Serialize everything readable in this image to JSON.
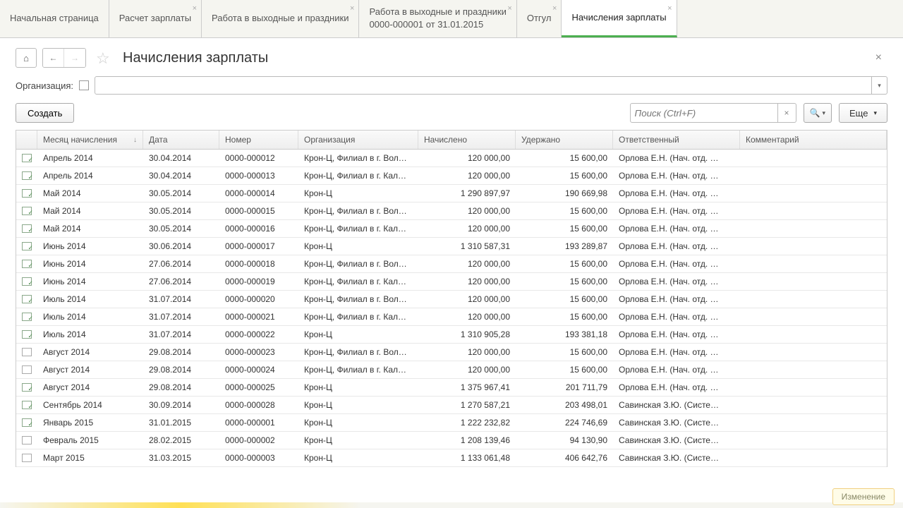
{
  "tabs": [
    {
      "label": "Начальная страница",
      "closable": false
    },
    {
      "label": "Расчет зарплаты",
      "closable": true
    },
    {
      "label": "Работа в выходные и праздники",
      "closable": true
    },
    {
      "label": "Работа в выходные и праздники\n0000-000001 от 31.01.2015",
      "closable": true
    },
    {
      "label": "Отгул",
      "closable": true
    },
    {
      "label": "Начисления зарплаты",
      "closable": true,
      "active": true
    }
  ],
  "pageTitle": "Начисления зарплаты",
  "filterLabel": "Организация:",
  "createBtn": "Создать",
  "searchPlaceholder": "Поиск (Ctrl+F)",
  "moreBtn": "Еще",
  "columns": {
    "month": "Месяц начисления",
    "date": "Дата",
    "number": "Номер",
    "org": "Организация",
    "accrued": "Начислено",
    "deducted": "Удержано",
    "responsible": "Ответственный",
    "comment": "Комментарий"
  },
  "popup": "Изменение",
  "rows": [
    {
      "posted": true,
      "month": "Апрель 2014",
      "date": "30.04.2014",
      "number": "0000-000012",
      "org": "Крон-Ц, Филиал в г. Вол…",
      "accrued": "120 000,00",
      "deducted": "15 600,00",
      "resp": "Орлова Е.Н. (Нач. отд. …"
    },
    {
      "posted": true,
      "month": "Апрель 2014",
      "date": "30.04.2014",
      "number": "0000-000013",
      "org": "Крон-Ц, Филиал в г. Кал…",
      "accrued": "120 000,00",
      "deducted": "15 600,00",
      "resp": "Орлова Е.Н. (Нач. отд. …"
    },
    {
      "posted": true,
      "month": "Май 2014",
      "date": "30.05.2014",
      "number": "0000-000014",
      "org": "Крон-Ц",
      "accrued": "1 290 897,97",
      "deducted": "190 669,98",
      "resp": "Орлова Е.Н. (Нач. отд. …"
    },
    {
      "posted": true,
      "month": "Май 2014",
      "date": "30.05.2014",
      "number": "0000-000015",
      "org": "Крон-Ц, Филиал в г. Вол…",
      "accrued": "120 000,00",
      "deducted": "15 600,00",
      "resp": "Орлова Е.Н. (Нач. отд. …"
    },
    {
      "posted": true,
      "month": "Май 2014",
      "date": "30.05.2014",
      "number": "0000-000016",
      "org": "Крон-Ц, Филиал в г. Кал…",
      "accrued": "120 000,00",
      "deducted": "15 600,00",
      "resp": "Орлова Е.Н. (Нач. отд. …"
    },
    {
      "posted": true,
      "month": "Июнь 2014",
      "date": "30.06.2014",
      "number": "0000-000017",
      "org": "Крон-Ц",
      "accrued": "1 310 587,31",
      "deducted": "193 289,87",
      "resp": "Орлова Е.Н. (Нач. отд. …"
    },
    {
      "posted": true,
      "month": "Июнь 2014",
      "date": "27.06.2014",
      "number": "0000-000018",
      "org": "Крон-Ц, Филиал в г. Вол…",
      "accrued": "120 000,00",
      "deducted": "15 600,00",
      "resp": "Орлова Е.Н. (Нач. отд. …"
    },
    {
      "posted": true,
      "month": "Июнь 2014",
      "date": "27.06.2014",
      "number": "0000-000019",
      "org": "Крон-Ц, Филиал в г. Кал…",
      "accrued": "120 000,00",
      "deducted": "15 600,00",
      "resp": "Орлова Е.Н. (Нач. отд. …"
    },
    {
      "posted": true,
      "month": "Июль 2014",
      "date": "31.07.2014",
      "number": "0000-000020",
      "org": "Крон-Ц, Филиал в г. Вол…",
      "accrued": "120 000,00",
      "deducted": "15 600,00",
      "resp": "Орлова Е.Н. (Нач. отд. …"
    },
    {
      "posted": true,
      "month": "Июль 2014",
      "date": "31.07.2014",
      "number": "0000-000021",
      "org": "Крон-Ц, Филиал в г. Кал…",
      "accrued": "120 000,00",
      "deducted": "15 600,00",
      "resp": "Орлова Е.Н. (Нач. отд. …"
    },
    {
      "posted": true,
      "month": "Июль 2014",
      "date": "31.07.2014",
      "number": "0000-000022",
      "org": "Крон-Ц",
      "accrued": "1 310 905,28",
      "deducted": "193 381,18",
      "resp": "Орлова Е.Н. (Нач. отд. …"
    },
    {
      "posted": false,
      "month": "Август 2014",
      "date": "29.08.2014",
      "number": "0000-000023",
      "org": "Крон-Ц, Филиал в г. Вол…",
      "accrued": "120 000,00",
      "deducted": "15 600,00",
      "resp": "Орлова Е.Н. (Нач. отд. …"
    },
    {
      "posted": false,
      "month": "Август 2014",
      "date": "29.08.2014",
      "number": "0000-000024",
      "org": "Крон-Ц, Филиал в г. Кал…",
      "accrued": "120 000,00",
      "deducted": "15 600,00",
      "resp": "Орлова Е.Н. (Нач. отд. …"
    },
    {
      "posted": true,
      "month": "Август 2014",
      "date": "29.08.2014",
      "number": "0000-000025",
      "org": "Крон-Ц",
      "accrued": "1 375 967,41",
      "deducted": "201 711,79",
      "resp": "Орлова Е.Н. (Нач. отд. …"
    },
    {
      "posted": true,
      "month": "Сентябрь 2014",
      "date": "30.09.2014",
      "number": "0000-000028",
      "org": "Крон-Ц",
      "accrued": "1 270 587,21",
      "deducted": "203 498,01",
      "resp": "Савинская З.Ю. (Систе…"
    },
    {
      "posted": true,
      "month": "Январь 2015",
      "date": "31.01.2015",
      "number": "0000-000001",
      "org": "Крон-Ц",
      "accrued": "1 222 232,82",
      "deducted": "224 746,69",
      "resp": "Савинская З.Ю. (Систе…"
    },
    {
      "posted": false,
      "month": "Февраль 2015",
      "date": "28.02.2015",
      "number": "0000-000002",
      "org": "Крон-Ц",
      "accrued": "1 208 139,46",
      "deducted": "94 130,90",
      "resp": "Савинская З.Ю. (Систе…"
    },
    {
      "posted": false,
      "month": "Март 2015",
      "date": "31.03.2015",
      "number": "0000-000003",
      "org": "Крон-Ц",
      "accrued": "1 133 061,48",
      "deducted": "406 642,76",
      "resp": "Савинская З.Ю. (Систе…"
    }
  ]
}
